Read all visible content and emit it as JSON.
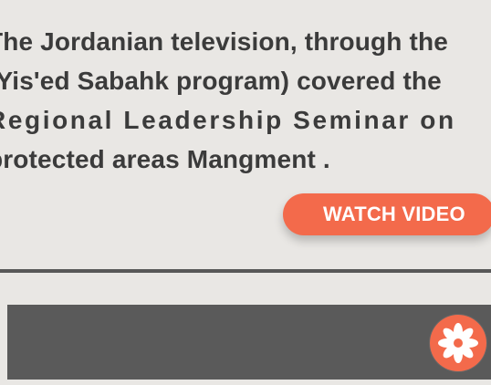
{
  "article": {
    "lines": [
      "The Jordanian television, through the",
      "(Yis'ed Sabahk program) covered the",
      "Regional  Leadership Seminar on",
      "protected areas Mangment ."
    ]
  },
  "video": {
    "button_label": "WATCH VIDEO"
  },
  "icons": {
    "panel_action": "flower-icon"
  },
  "colors": {
    "background": "#e9e7e4",
    "text": "#3b3b3b",
    "accent": "#f36a4b",
    "panel": "#5a5a5a",
    "divider": "#585858"
  }
}
